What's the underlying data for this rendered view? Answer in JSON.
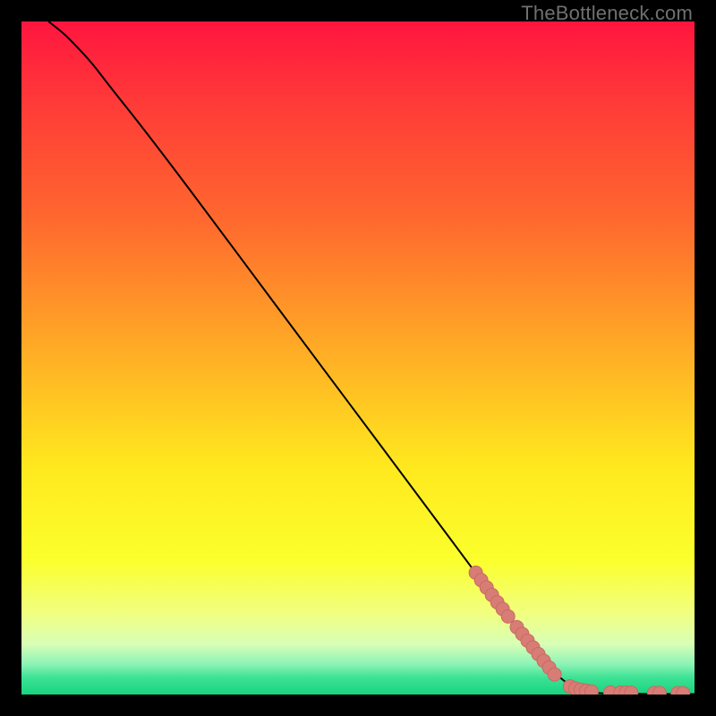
{
  "watermark": "TheBottleneck.com",
  "colors": {
    "frame": "#000000",
    "curve": "#000000",
    "marker_fill": "#d77d75",
    "marker_stroke": "#c86a62"
  },
  "chart_data": {
    "type": "line",
    "title": "",
    "xlabel": "",
    "ylabel": "",
    "xlim": [
      0,
      100
    ],
    "ylim": [
      0,
      100
    ],
    "gradient_stops": [
      {
        "offset": 0.0,
        "color": "#ff153f"
      },
      {
        "offset": 0.12,
        "color": "#ff3a38"
      },
      {
        "offset": 0.3,
        "color": "#ff6a2e"
      },
      {
        "offset": 0.5,
        "color": "#ffb025"
      },
      {
        "offset": 0.66,
        "color": "#ffe81e"
      },
      {
        "offset": 0.8,
        "color": "#fbff2c"
      },
      {
        "offset": 0.88,
        "color": "#f1ff81"
      },
      {
        "offset": 0.925,
        "color": "#d8ffb6"
      },
      {
        "offset": 0.955,
        "color": "#8cf3b6"
      },
      {
        "offset": 0.975,
        "color": "#3ce294"
      },
      {
        "offset": 1.0,
        "color": "#17d47f"
      }
    ],
    "curve_points": [
      {
        "x": 4.0,
        "y": 100.0
      },
      {
        "x": 6.0,
        "y": 98.5
      },
      {
        "x": 8.0,
        "y": 96.5
      },
      {
        "x": 10.5,
        "y": 93.8
      },
      {
        "x": 13.0,
        "y": 90.5
      },
      {
        "x": 17.0,
        "y": 85.5
      },
      {
        "x": 22.0,
        "y": 79.0
      },
      {
        "x": 28.0,
        "y": 71.0
      },
      {
        "x": 35.0,
        "y": 61.6
      },
      {
        "x": 42.0,
        "y": 52.2
      },
      {
        "x": 50.0,
        "y": 41.5
      },
      {
        "x": 58.0,
        "y": 30.8
      },
      {
        "x": 65.0,
        "y": 21.4
      },
      {
        "x": 72.0,
        "y": 12.0
      },
      {
        "x": 78.0,
        "y": 4.4
      },
      {
        "x": 81.0,
        "y": 1.6
      },
      {
        "x": 83.5,
        "y": 0.4
      },
      {
        "x": 86.0,
        "y": 0.15
      },
      {
        "x": 90.0,
        "y": 0.1
      },
      {
        "x": 95.0,
        "y": 0.08
      },
      {
        "x": 100.0,
        "y": 0.07
      }
    ],
    "series": [
      {
        "name": "markers",
        "points": [
          {
            "x": 67.5,
            "y": 18.1
          },
          {
            "x": 68.3,
            "y": 17.0
          },
          {
            "x": 69.1,
            "y": 15.9
          },
          {
            "x": 69.9,
            "y": 14.8
          },
          {
            "x": 70.7,
            "y": 13.7
          },
          {
            "x": 71.5,
            "y": 12.7
          },
          {
            "x": 72.3,
            "y": 11.6
          },
          {
            "x": 73.6,
            "y": 10.0
          },
          {
            "x": 74.4,
            "y": 9.0
          },
          {
            "x": 75.2,
            "y": 8.0
          },
          {
            "x": 76.0,
            "y": 7.0
          },
          {
            "x": 76.8,
            "y": 6.0
          },
          {
            "x": 77.6,
            "y": 5.0
          },
          {
            "x": 78.4,
            "y": 4.0
          },
          {
            "x": 79.2,
            "y": 3.0
          },
          {
            "x": 81.5,
            "y": 1.2
          },
          {
            "x": 82.3,
            "y": 0.9
          },
          {
            "x": 83.1,
            "y": 0.7
          },
          {
            "x": 83.9,
            "y": 0.55
          },
          {
            "x": 84.7,
            "y": 0.45
          },
          {
            "x": 87.5,
            "y": 0.3
          },
          {
            "x": 89.0,
            "y": 0.27
          },
          {
            "x": 89.8,
            "y": 0.26
          },
          {
            "x": 90.6,
            "y": 0.25
          },
          {
            "x": 94.0,
            "y": 0.22
          },
          {
            "x": 94.8,
            "y": 0.21
          },
          {
            "x": 97.5,
            "y": 0.2
          },
          {
            "x": 98.3,
            "y": 0.19
          }
        ]
      }
    ]
  }
}
